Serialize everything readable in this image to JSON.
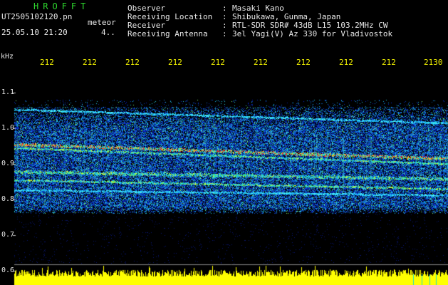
{
  "header": {
    "app_name": "HROFFT",
    "filename": "UT2505102120.pn",
    "meteor_label": "meteor",
    "datetime": "25.05.10 21:20",
    "count": "4..",
    "fields": [
      {
        "label": "Observer",
        "sep": ":",
        "value": "Masaki Kano"
      },
      {
        "label": "Receiving Location",
        "sep": ":",
        "value": "Shibukawa, Gunma, Japan"
      },
      {
        "label": "Receiver",
        "sep": ":",
        "value": "RTL-SDR SDR# 43dB L15 103.2MHz CW"
      },
      {
        "label": "Receiving Antenna",
        "sep": ":",
        "value": "3el Yagi(V) Az 330 for Vladivostok"
      }
    ]
  },
  "axis": {
    "y_unit": "kHz",
    "y_ticks": [
      "1.1",
      "1.0",
      "0.9",
      "0.8",
      "0.7",
      "0.6"
    ],
    "x_ticks": [
      "212",
      "212",
      "212",
      "212",
      "212",
      "212",
      "212",
      "212",
      "212",
      "2130"
    ]
  },
  "colors": {
    "background": "#000000",
    "header_text": "#e8e8e8",
    "title_green": "#2ed82e",
    "tick_yellow": "#f0f000",
    "noise_blue": "#0a20c8",
    "signal_red": "#ff2020",
    "level_bar": "#ffff00"
  }
}
